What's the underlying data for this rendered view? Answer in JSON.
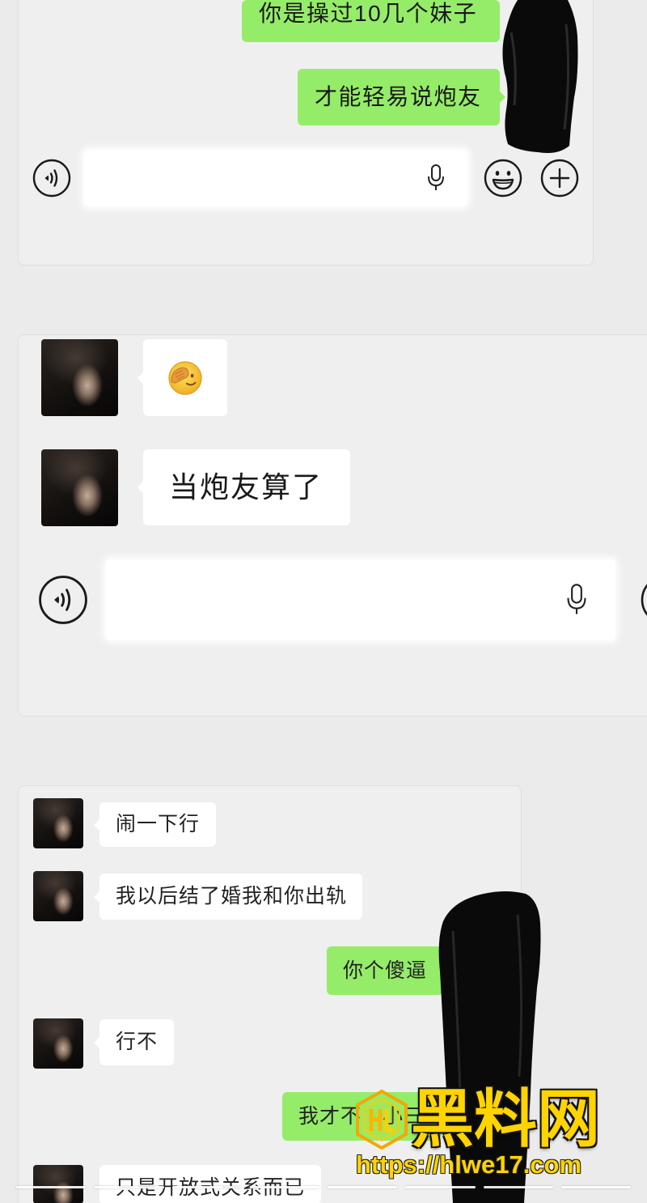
{
  "chats": {
    "chat1": {
      "messages": [
        {
          "outgoing": true,
          "text": "你是操过10几个妹子"
        },
        {
          "outgoing": true,
          "text": "才能轻易说炮友"
        }
      ],
      "input": {
        "value": ""
      },
      "toolbar_icons": [
        "voice-icon",
        "mic-icon",
        "emoji-icon",
        "plus-icon"
      ]
    },
    "chat2": {
      "messages": [
        {
          "outgoing": false,
          "icon": "facepalm-emoji-icon"
        },
        {
          "outgoing": false,
          "text": "当炮友算了"
        }
      ],
      "input": {
        "value": ""
      },
      "toolbar_icons": [
        "voice-icon",
        "mic-icon"
      ]
    },
    "chat3": {
      "messages": [
        {
          "outgoing": false,
          "text": "闹一下行"
        },
        {
          "outgoing": false,
          "text": "我以后结了婚我和你出轨"
        },
        {
          "outgoing": true,
          "text": "你个傻逼"
        },
        {
          "outgoing": false,
          "text": "行不"
        },
        {
          "outgoing": true,
          "text_parts": [
            "我才不",
            "小三"
          ]
        },
        {
          "outgoing": false,
          "text": "只是开放式关系而已"
        }
      ]
    }
  },
  "watermark": {
    "logo_text": "HL",
    "site_name": "黑料网",
    "url": "https://hlwe17.com"
  },
  "colors": {
    "sent_bubble": "#95ec69",
    "received_bubble": "#ffffff",
    "chat_background": "#efefef",
    "page_background": "#ebebeb",
    "watermark_yellow": "#ffd400",
    "redaction": "#0a0a0a"
  }
}
